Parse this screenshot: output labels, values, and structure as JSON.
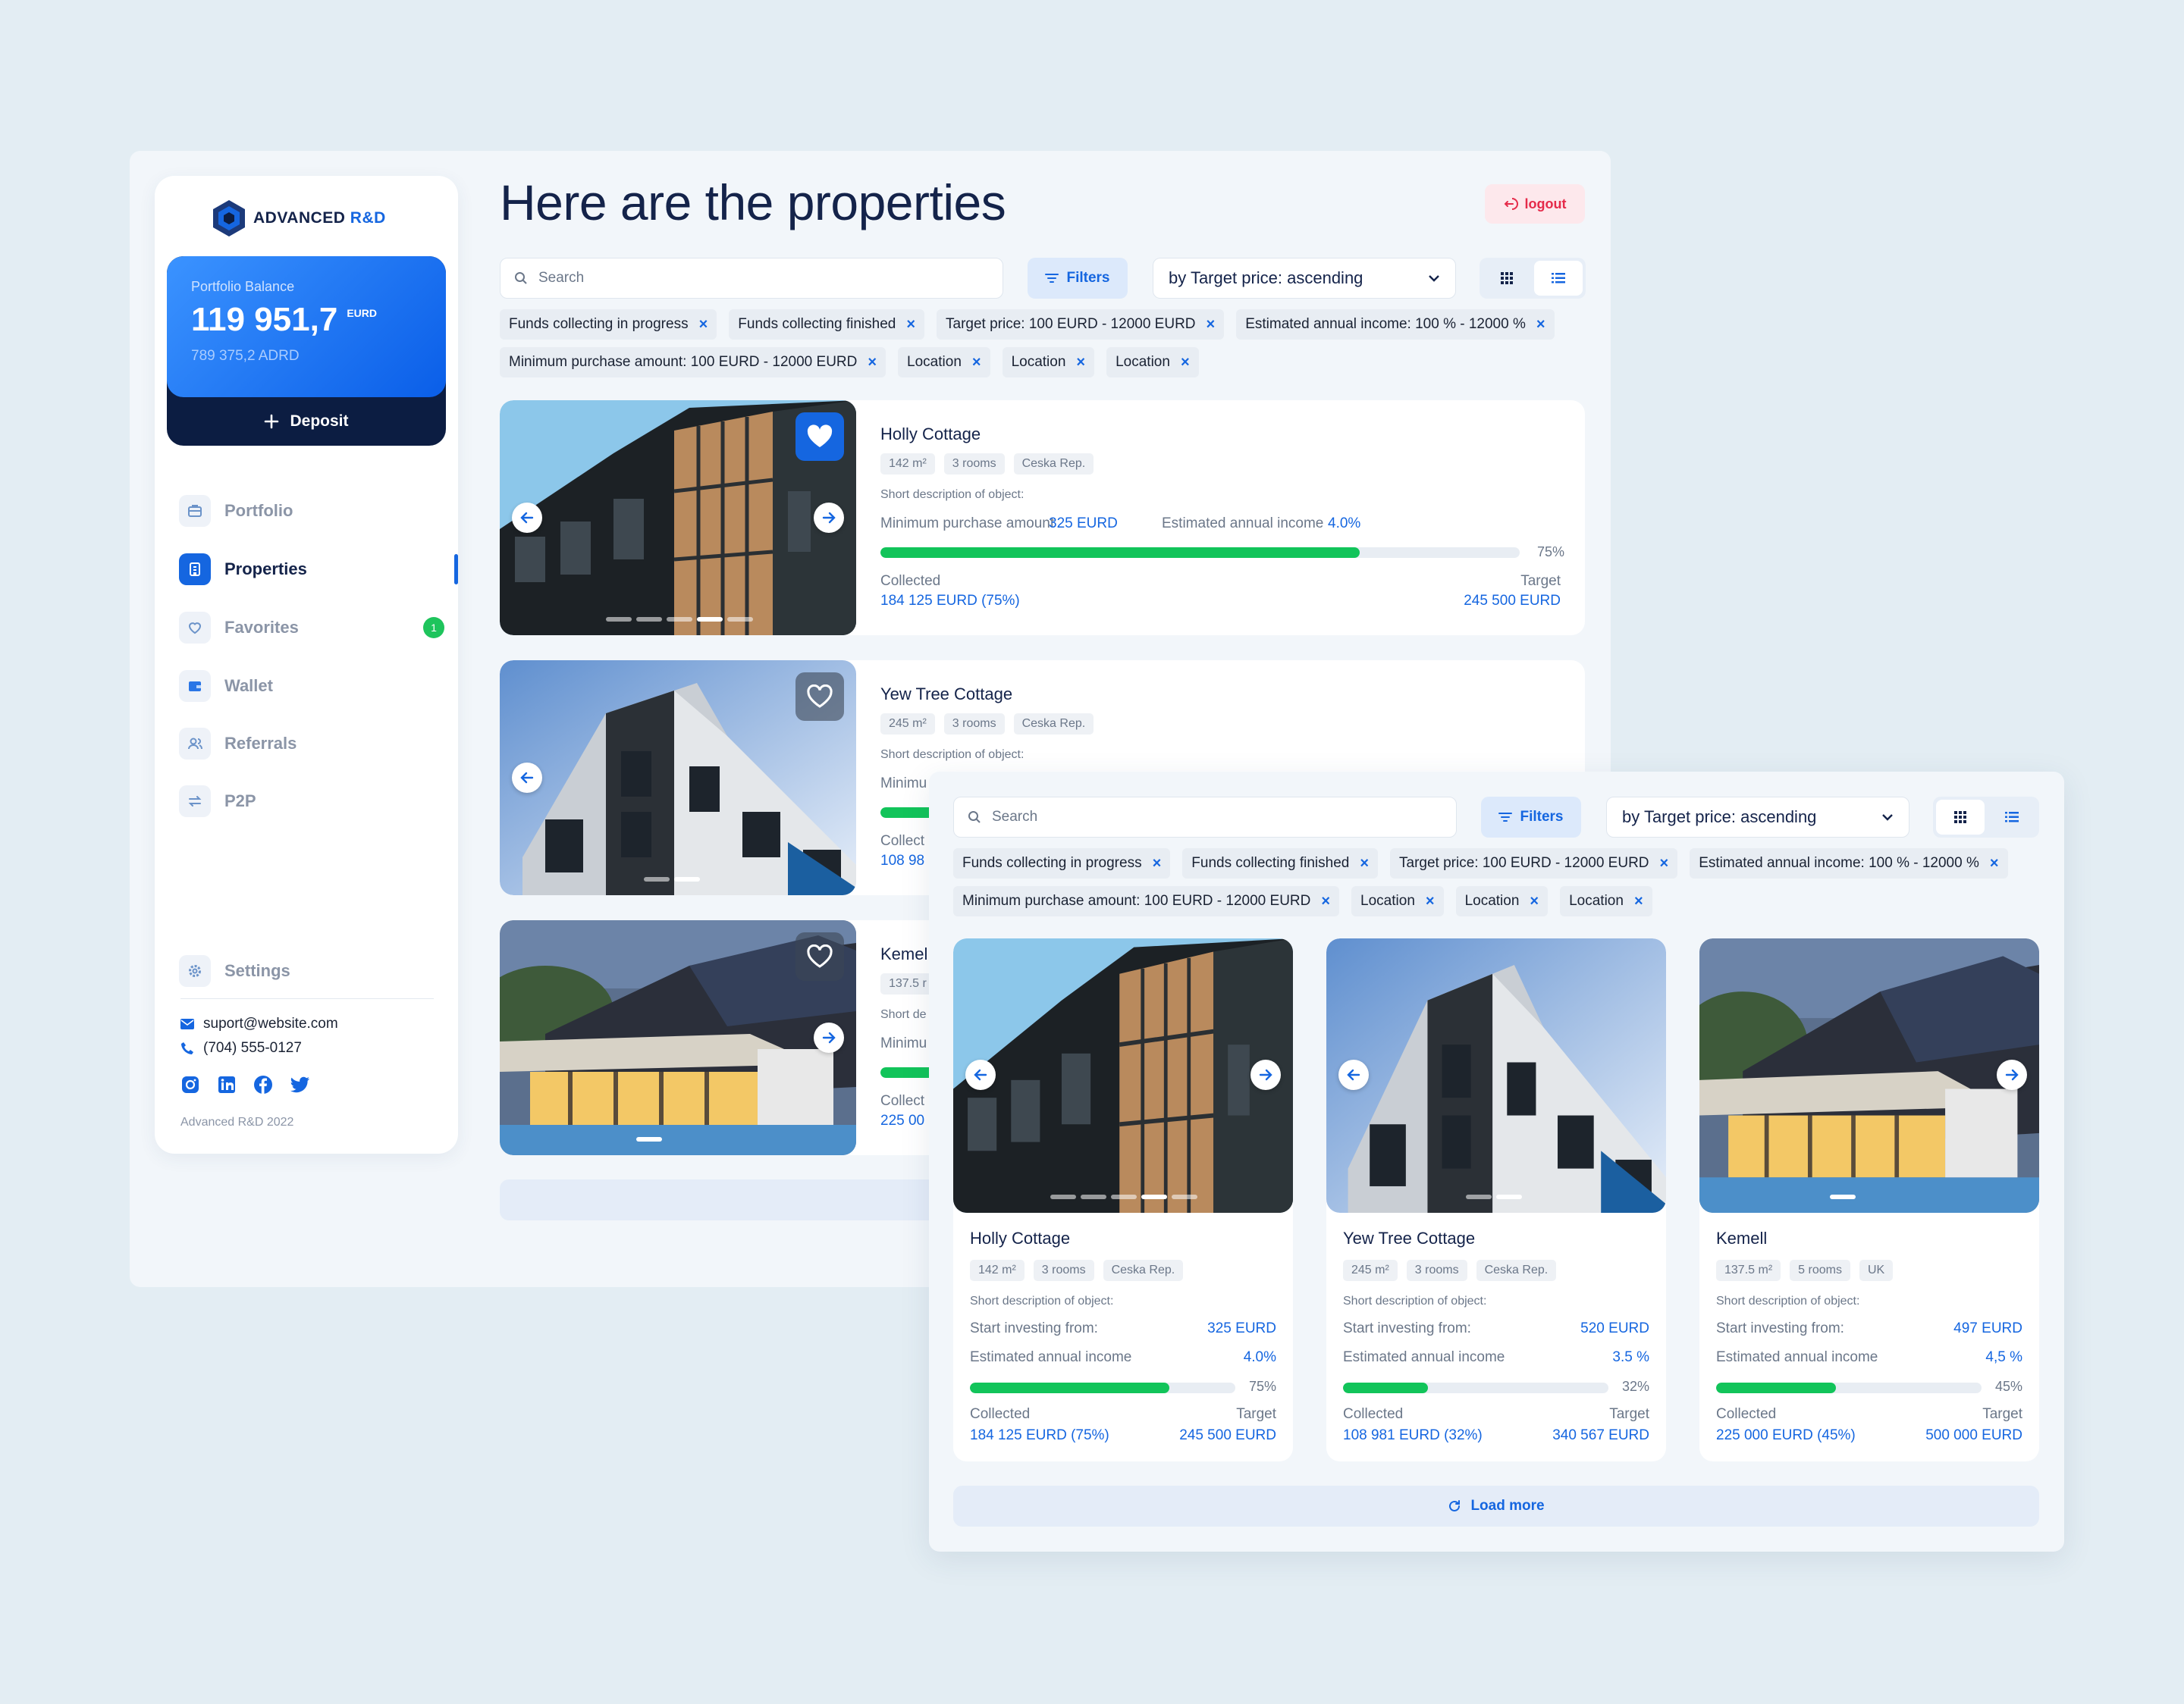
{
  "brand": {
    "name_main": "ADVANCED",
    "name_accent": "R&D"
  },
  "balance": {
    "label": "Portfolio Balance",
    "value": "119 951,7",
    "currency": "EURD",
    "secondary": "789 375,2 ADRD",
    "deposit_label": "Deposit"
  },
  "nav": [
    {
      "label": "Portfolio",
      "icon": "briefcase-icon"
    },
    {
      "label": "Properties",
      "icon": "building-icon",
      "active": true
    },
    {
      "label": "Favorites",
      "icon": "heart-icon",
      "badge": "1"
    },
    {
      "label": "Wallet",
      "icon": "wallet-icon"
    },
    {
      "label": "Referrals",
      "icon": "users-icon"
    },
    {
      "label": "P2P",
      "icon": "swap-icon"
    }
  ],
  "settings_label": "Settings",
  "contact": {
    "email": "suport@website.com",
    "phone": "(704) 555-0127"
  },
  "copyright": "Advanced R&D 2022",
  "header": {
    "title": "Here are the properties",
    "logout": "logout"
  },
  "toolbar": {
    "search_placeholder": "Search",
    "filters": "Filters",
    "sort": "by Target price: ascending"
  },
  "chips": [
    "Funds collecting in progress",
    "Funds collecting finished",
    "Target price: 100 EURD - 12000 EURD",
    "Estimated annual income: 100 % - 12000 %",
    "Minimum purchase amount: 100 EURD - 12000 EURD",
    "Location",
    "Location",
    "Location"
  ],
  "list_view": {
    "min_label": "Minimum purchase amount",
    "income_label": "Estimated annual income",
    "desc_label": "Short description of object:",
    "collected_label": "Collected",
    "target_label": "Target",
    "items": [
      {
        "name": "Holly Cottage",
        "tags": [
          "142 m²",
          "3 rooms",
          "Ceska Rep."
        ],
        "min": "325 EURD",
        "income": "4.0%",
        "progress": 75,
        "pct": "75%",
        "collected": "184 125 EURD (75%)",
        "target": "245 500 EURD"
      },
      {
        "name": "Yew Tree Cottage",
        "tags": [
          "245 m²",
          "3 rooms",
          "Ceska Rep."
        ],
        "desc_cut": "Minimu",
        "collected_cut": "Collect",
        "value_cut": "108 98"
      },
      {
        "name_cut": "Kemel",
        "tag_cut": "137.5 r",
        "desc_cut": "Short de",
        "min_cut": "Minimu",
        "collected_cut": "Collect",
        "value_cut": "225 00"
      }
    ]
  },
  "grid_view": {
    "start_label": "Start investing from:",
    "income_label": "Estimated annual income",
    "desc_label": "Short description of object:",
    "collected_label": "Collected",
    "target_label": "Target",
    "load_more": "Load more",
    "items": [
      {
        "name": "Holly Cottage",
        "tags": [
          "142 m²",
          "3 rooms",
          "Ceska Rep."
        ],
        "start": "325 EURD",
        "income": "4.0%",
        "progress": 75,
        "pct": "75%",
        "collected": "184 125 EURD (75%)",
        "target": "245 500 EURD"
      },
      {
        "name": "Yew Tree Cottage",
        "tags": [
          "245 m²",
          "3 rooms",
          "Ceska Rep."
        ],
        "start": "520 EURD",
        "income": "3.5 %",
        "progress": 32,
        "pct": "32%",
        "collected": "108 981 EURD (32%)",
        "target": "340 567 EURD"
      },
      {
        "name": "Kemell",
        "tags": [
          "137.5 m²",
          "5 rooms",
          "UK"
        ],
        "start": "497 EURD",
        "income": "4,5 %",
        "progress": 45,
        "pct": "45%",
        "collected": "225 000 EURD (45%)",
        "target": "500 000 EURD"
      }
    ]
  },
  "colors": {
    "accent": "#1566e0",
    "progress": "#12c45a",
    "logout": "#e52b4a",
    "navy": "#0c1d42"
  }
}
